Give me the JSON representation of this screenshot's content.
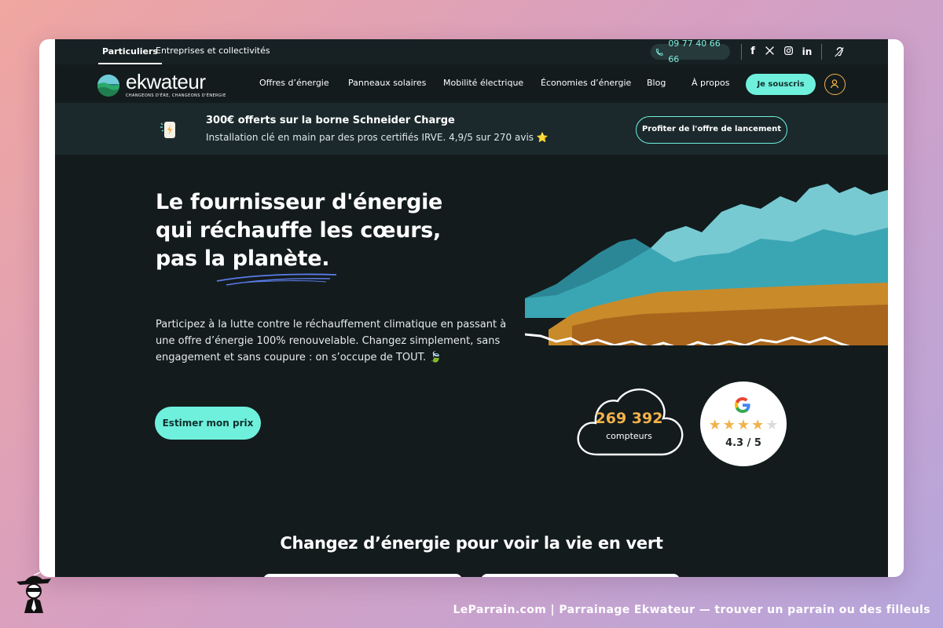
{
  "topbar": {
    "tabs": [
      {
        "label": "Particuliers"
      },
      {
        "label": "Entreprises et collectivités"
      }
    ],
    "phone": "09 77 40 66 66",
    "socials": [
      "facebook-icon",
      "x-icon",
      "instagram-icon",
      "linkedin-icon"
    ],
    "accessibility_icon": "ear-accessibility-icon"
  },
  "nav": {
    "logo_text": "ekwateur",
    "logo_tagline": "CHANGEONS D'ÈRE, CHANGEONS D'ÉNERGIE",
    "items": [
      {
        "label": "Offres d’énergie"
      },
      {
        "label": "Panneaux solaires"
      },
      {
        "label": "Mobilité électrique"
      },
      {
        "label": "Économies d’énergie"
      },
      {
        "label": "Blog"
      },
      {
        "label": "À propos"
      }
    ],
    "subscribe_label": "Je souscris"
  },
  "promo": {
    "title": "300€ offerts sur la borne Schneider Charge",
    "subtitle": "Installation clé en main par des pros certifiés IRVE. 4,9/5 sur 270 avis ⭐",
    "button_label": "Profiter de l'offre de lancement"
  },
  "hero": {
    "title_lines": [
      "Le fournisseur d'énergie",
      "qui réchauffe les cœurs,",
      "pas la planète."
    ],
    "description": "Participez à la lutte contre le réchauffement climatique en passant à une offre d’énergie 100% renouvelable. Changez simplement, sans engagement et sans coupure : on s’occupe de TOUT. 🍃",
    "cta_label": "Estimer mon prix"
  },
  "stats": {
    "meters_count": "269 392",
    "meters_label": "compteurs",
    "rating_stars": 4.3,
    "rating_text": "4.3 / 5"
  },
  "section": {
    "title": "Changez d’énergie pour voir la vie en vert"
  },
  "colors": {
    "accent": "#6ff0dd",
    "background": "#131b1d",
    "gold": "#f2b24a"
  },
  "watermark": {
    "text": "LeParrain.com | Parrainage Ekwateur — trouver un parrain ou des filleuls"
  }
}
